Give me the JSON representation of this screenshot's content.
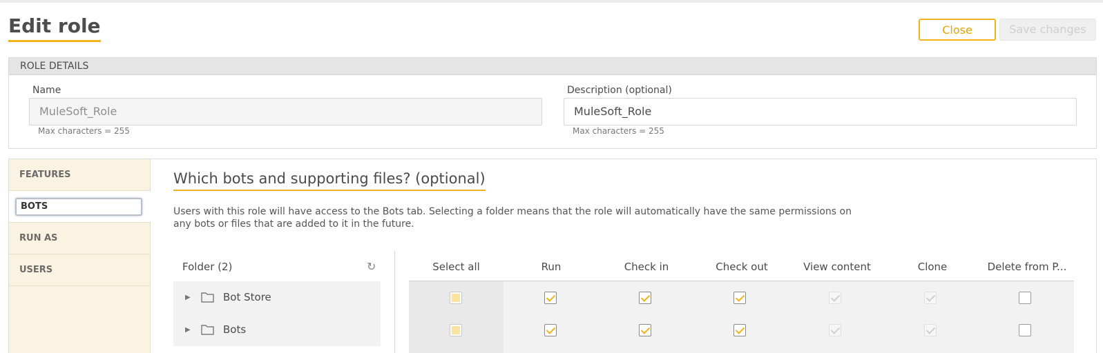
{
  "page": {
    "title": "Edit role"
  },
  "actions": {
    "close_label": "Close",
    "save_label": "Save changes"
  },
  "role_details": {
    "header": "ROLE DETAILS",
    "name_label": "Name",
    "name_value": "MuleSoft_Role",
    "name_hint": "Max characters = 255",
    "description_label": "Description (optional)",
    "description_value": "MuleSoft_Role",
    "description_hint": "Max characters = 255"
  },
  "sidebar": {
    "items": [
      {
        "label": "FEATURES"
      },
      {
        "label": "BOTS",
        "active": true
      },
      {
        "label": "RUN AS"
      },
      {
        "label": "USERS"
      }
    ]
  },
  "bots_section": {
    "title": "Which bots and supporting files? (optional)",
    "description": "Users with this role will have access to the Bots tab. Selecting a folder means that the role will automatically have the same permissions on any bots or files that are added to it in the future.",
    "folder_header": "Folder (2)",
    "folders": [
      {
        "name": "Bot Store"
      },
      {
        "name": "Bots"
      }
    ],
    "columns": [
      "Select all",
      "Run",
      "Check in",
      "Check out",
      "View content",
      "Clone",
      "Delete from P..."
    ],
    "rows": [
      {
        "select_all": "partial",
        "run": "checked",
        "check_in": "checked",
        "check_out": "checked",
        "view_content": "disabled-checked",
        "clone": "disabled-checked",
        "delete": "unchecked"
      },
      {
        "select_all": "partial",
        "run": "checked",
        "check_in": "checked",
        "check_out": "checked",
        "view_content": "disabled-checked",
        "clone": "disabled-checked",
        "delete": "unchecked"
      }
    ]
  },
  "colors": {
    "accent": "#f2b21a",
    "sidebar_bg": "#fbf3e2",
    "header_bg": "#e5e5e5"
  },
  "icons": {
    "refresh": "refresh-icon",
    "folder": "folder-icon",
    "expand": "caret-right-icon"
  }
}
